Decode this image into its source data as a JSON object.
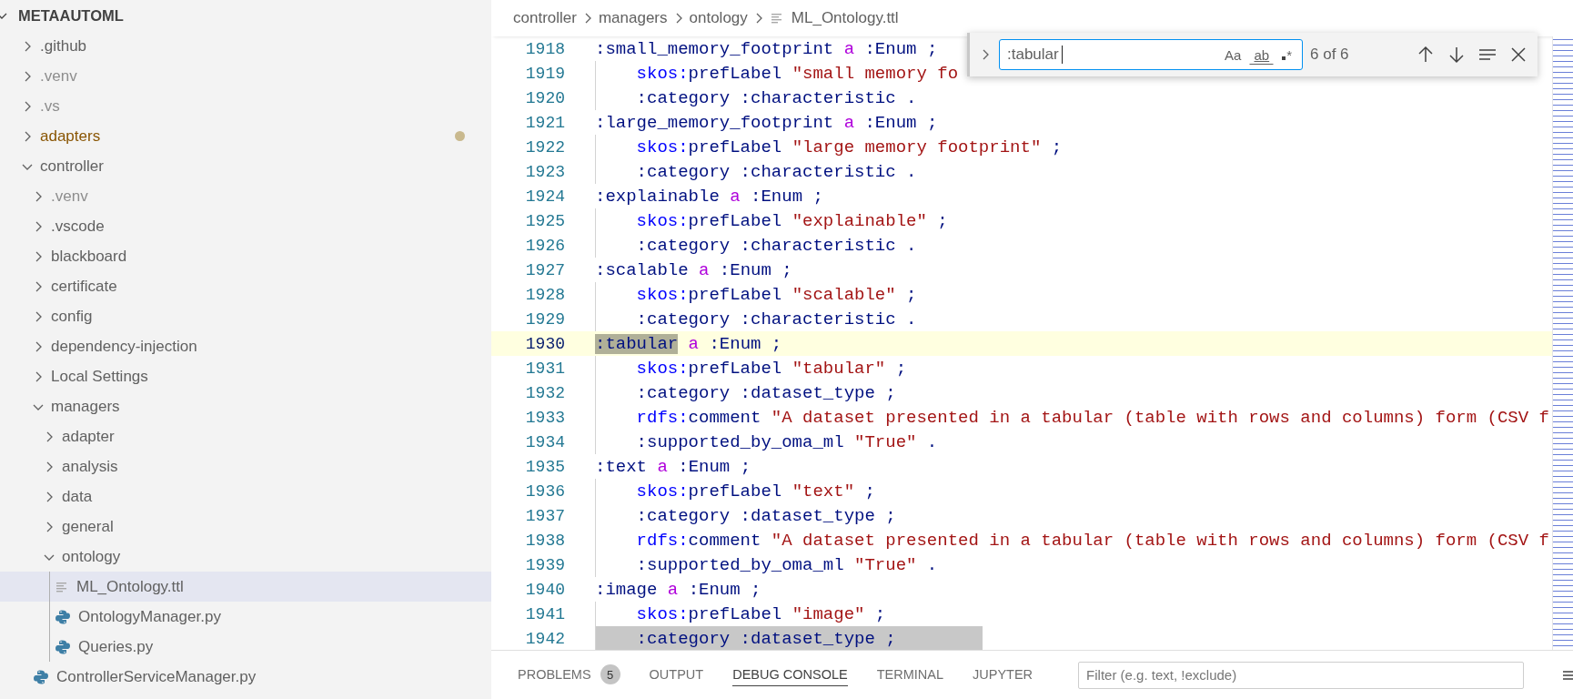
{
  "explorer": {
    "title": "METAAUTOML",
    "expanded": true,
    "items": [
      {
        "label": ".github",
        "kind": "folder",
        "expanded": false,
        "ignored": false,
        "modified": false,
        "selected": false
      },
      {
        "label": ".venv",
        "kind": "folder",
        "expanded": false,
        "ignored": true,
        "modified": false,
        "selected": false
      },
      {
        "label": ".vs",
        "kind": "folder",
        "expanded": false,
        "ignored": true,
        "modified": false,
        "selected": false
      },
      {
        "label": "adapters",
        "kind": "folder",
        "expanded": false,
        "ignored": false,
        "modified": true,
        "selected": false
      },
      {
        "label": "controller",
        "kind": "folder",
        "expanded": true,
        "ignored": false,
        "modified": false,
        "selected": false,
        "children": [
          {
            "label": ".venv",
            "kind": "folder",
            "expanded": false,
            "ignored": true,
            "modified": false,
            "selected": false
          },
          {
            "label": ".vscode",
            "kind": "folder",
            "expanded": false,
            "ignored": false,
            "modified": false,
            "selected": false
          },
          {
            "label": "blackboard",
            "kind": "folder",
            "expanded": false,
            "ignored": false,
            "modified": false,
            "selected": false
          },
          {
            "label": "certificate",
            "kind": "folder",
            "expanded": false,
            "ignored": false,
            "modified": false,
            "selected": false
          },
          {
            "label": "config",
            "kind": "folder",
            "expanded": false,
            "ignored": false,
            "modified": false,
            "selected": false
          },
          {
            "label": "dependency-injection",
            "kind": "folder",
            "expanded": false,
            "ignored": false,
            "modified": false,
            "selected": false
          },
          {
            "label": "Local Settings",
            "kind": "folder",
            "expanded": false,
            "ignored": false,
            "modified": false,
            "selected": false
          },
          {
            "label": "managers",
            "kind": "folder",
            "expanded": true,
            "ignored": false,
            "modified": false,
            "selected": false,
            "children": [
              {
                "label": "adapter",
                "kind": "folder",
                "expanded": false,
                "ignored": false,
                "modified": false,
                "selected": false
              },
              {
                "label": "analysis",
                "kind": "folder",
                "expanded": false,
                "ignored": false,
                "modified": false,
                "selected": false
              },
              {
                "label": "data",
                "kind": "folder",
                "expanded": false,
                "ignored": false,
                "modified": false,
                "selected": false
              },
              {
                "label": "general",
                "kind": "folder",
                "expanded": false,
                "ignored": false,
                "modified": false,
                "selected": false
              },
              {
                "label": "ontology",
                "kind": "folder",
                "expanded": true,
                "ignored": false,
                "modified": false,
                "selected": false,
                "children": [
                  {
                    "label": "ML_Ontology.ttl",
                    "kind": "text",
                    "ignored": false,
                    "modified": false,
                    "selected": true
                  },
                  {
                    "label": "OntologyManager.py",
                    "kind": "python",
                    "ignored": false,
                    "modified": false,
                    "selected": false
                  },
                  {
                    "label": "Queries.py",
                    "kind": "python",
                    "ignored": false,
                    "modified": false,
                    "selected": false
                  }
                ]
              }
            ]
          },
          {
            "label": "ControllerServiceManager.py",
            "kind": "python",
            "ignored": false,
            "modified": false,
            "selected": false
          }
        ]
      }
    ]
  },
  "breadcrumb": [
    {
      "label": "controller",
      "kind": "folder"
    },
    {
      "label": "managers",
      "kind": "folder"
    },
    {
      "label": "ontology",
      "kind": "folder"
    },
    {
      "label": "ML_Ontology.ttl",
      "kind": "file"
    }
  ],
  "editor": {
    "lines": [
      {
        "number": "1918",
        "indented": false,
        "current": false,
        "selected": false,
        "tokens": [
          {
            "kind": "name",
            "text": ":small_memory_footprint "
          },
          {
            "kind": "keyword",
            "text": "a"
          },
          {
            "kind": "name",
            "text": " :Enum ;"
          }
        ]
      },
      {
        "number": "1919",
        "indented": true,
        "current": false,
        "selected": false,
        "tokens": [
          {
            "kind": "prefix",
            "text": "skos:"
          },
          {
            "kind": "name",
            "text": "prefLabel "
          },
          {
            "kind": "string",
            "text": "\"small memory fo"
          }
        ]
      },
      {
        "number": "1920",
        "indented": true,
        "current": false,
        "selected": false,
        "tokens": [
          {
            "kind": "name",
            "text": ":category :characteristic ."
          }
        ]
      },
      {
        "number": "1921",
        "indented": false,
        "current": false,
        "selected": false,
        "tokens": [
          {
            "kind": "name",
            "text": ":large_memory_footprint "
          },
          {
            "kind": "keyword",
            "text": "a"
          },
          {
            "kind": "name",
            "text": " :Enum ;"
          }
        ]
      },
      {
        "number": "1922",
        "indented": true,
        "current": false,
        "selected": false,
        "tokens": [
          {
            "kind": "prefix",
            "text": "skos:"
          },
          {
            "kind": "name",
            "text": "prefLabel "
          },
          {
            "kind": "string",
            "text": "\"large memory footprint\""
          },
          {
            "kind": "name",
            "text": " ;"
          }
        ]
      },
      {
        "number": "1923",
        "indented": true,
        "current": false,
        "selected": false,
        "tokens": [
          {
            "kind": "name",
            "text": ":category :characteristic ."
          }
        ]
      },
      {
        "number": "1924",
        "indented": false,
        "current": false,
        "selected": false,
        "tokens": [
          {
            "kind": "name",
            "text": ":explainable "
          },
          {
            "kind": "keyword",
            "text": "a"
          },
          {
            "kind": "name",
            "text": " :Enum ;"
          }
        ]
      },
      {
        "number": "1925",
        "indented": true,
        "current": false,
        "selected": false,
        "tokens": [
          {
            "kind": "prefix",
            "text": "skos:"
          },
          {
            "kind": "name",
            "text": "prefLabel "
          },
          {
            "kind": "string",
            "text": "\"explainable\""
          },
          {
            "kind": "name",
            "text": " ;"
          }
        ]
      },
      {
        "number": "1926",
        "indented": true,
        "current": false,
        "selected": false,
        "tokens": [
          {
            "kind": "name",
            "text": ":category :characteristic ."
          }
        ]
      },
      {
        "number": "1927",
        "indented": false,
        "current": false,
        "selected": false,
        "tokens": [
          {
            "kind": "name",
            "text": ":scalable "
          },
          {
            "kind": "keyword",
            "text": "a"
          },
          {
            "kind": "name",
            "text": " :Enum ;"
          }
        ]
      },
      {
        "number": "1928",
        "indented": true,
        "current": false,
        "selected": false,
        "tokens": [
          {
            "kind": "prefix",
            "text": "skos:"
          },
          {
            "kind": "name",
            "text": "prefLabel "
          },
          {
            "kind": "string",
            "text": "\"scalable\""
          },
          {
            "kind": "name",
            "text": " ;"
          }
        ]
      },
      {
        "number": "1929",
        "indented": true,
        "current": false,
        "selected": false,
        "tokens": [
          {
            "kind": "name",
            "text": ":category :characteristic ."
          }
        ]
      },
      {
        "number": "1930",
        "indented": false,
        "current": true,
        "selected": false,
        "tokens": [
          {
            "kind": "name",
            "text": ":tabular",
            "match": true
          },
          {
            "kind": "keyword",
            "text": " a",
            "match": false
          },
          {
            "kind": "name",
            "text": " :Enum ;",
            "match": false
          }
        ]
      },
      {
        "number": "1931",
        "indented": true,
        "current": false,
        "selected": false,
        "tokens": [
          {
            "kind": "prefix",
            "text": "skos:"
          },
          {
            "kind": "name",
            "text": "prefLabel "
          },
          {
            "kind": "string",
            "text": "\"tabular\""
          },
          {
            "kind": "name",
            "text": " ;"
          }
        ]
      },
      {
        "number": "1932",
        "indented": true,
        "current": false,
        "selected": false,
        "tokens": [
          {
            "kind": "name",
            "text": ":category :dataset_type ;"
          }
        ]
      },
      {
        "number": "1933",
        "indented": true,
        "current": false,
        "selected": false,
        "tokens": [
          {
            "kind": "prefix",
            "text": "rdfs:"
          },
          {
            "kind": "name",
            "text": "comment "
          },
          {
            "kind": "string",
            "text": "\"A dataset presented in a tabular (table with rows and columns) form (CSV f"
          }
        ]
      },
      {
        "number": "1934",
        "indented": true,
        "current": false,
        "selected": false,
        "tokens": [
          {
            "kind": "name",
            "text": ":supported_by_oma_ml "
          },
          {
            "kind": "string",
            "text": "\"True\""
          },
          {
            "kind": "name",
            "text": " ."
          }
        ]
      },
      {
        "number": "1935",
        "indented": false,
        "current": false,
        "selected": false,
        "tokens": [
          {
            "kind": "name",
            "text": ":text "
          },
          {
            "kind": "keyword",
            "text": "a"
          },
          {
            "kind": "name",
            "text": " :Enum ;"
          }
        ]
      },
      {
        "number": "1936",
        "indented": true,
        "current": false,
        "selected": false,
        "tokens": [
          {
            "kind": "prefix",
            "text": "skos:"
          },
          {
            "kind": "name",
            "text": "prefLabel "
          },
          {
            "kind": "string",
            "text": "\"text\""
          },
          {
            "kind": "name",
            "text": " ;"
          }
        ]
      },
      {
        "number": "1937",
        "indented": true,
        "current": false,
        "selected": false,
        "tokens": [
          {
            "kind": "name",
            "text": ":category :dataset_type ;"
          }
        ]
      },
      {
        "number": "1938",
        "indented": true,
        "current": false,
        "selected": false,
        "tokens": [
          {
            "kind": "prefix",
            "text": "rdfs:"
          },
          {
            "kind": "name",
            "text": "comment "
          },
          {
            "kind": "string",
            "text": "\"A dataset presented in a tabular (table with rows and columns) form (CSV f"
          }
        ]
      },
      {
        "number": "1939",
        "indented": true,
        "current": false,
        "selected": false,
        "tokens": [
          {
            "kind": "name",
            "text": ":supported_by_oma_ml "
          },
          {
            "kind": "string",
            "text": "\"True\""
          },
          {
            "kind": "name",
            "text": " ."
          }
        ]
      },
      {
        "number": "1940",
        "indented": false,
        "current": false,
        "selected": false,
        "tokens": [
          {
            "kind": "name",
            "text": ":image "
          },
          {
            "kind": "keyword",
            "text": "a"
          },
          {
            "kind": "name",
            "text": " :Enum ;"
          }
        ]
      },
      {
        "number": "1941",
        "indented": true,
        "current": false,
        "selected": false,
        "tokens": [
          {
            "kind": "prefix",
            "text": "skos:"
          },
          {
            "kind": "name",
            "text": "prefLabel "
          },
          {
            "kind": "string",
            "text": "\"image\""
          },
          {
            "kind": "name",
            "text": " ;"
          }
        ]
      },
      {
        "number": "1942",
        "indented": true,
        "current": false,
        "selected": true,
        "tokens": [
          {
            "kind": "name",
            "text": ":category :dataset_type ;"
          }
        ]
      }
    ]
  },
  "find": {
    "expanded": false,
    "value": ":tabular",
    "options": [
      {
        "label": "Aa",
        "kind": "case",
        "on": false
      },
      {
        "label": "ab",
        "kind": "word",
        "on": false
      },
      {
        "label": "*",
        "kind": "regex",
        "on": false
      }
    ],
    "count": "6 of 6"
  },
  "panel": {
    "tabs": [
      {
        "label": "PROBLEMS",
        "badge": "5",
        "selected": false
      },
      {
        "label": "OUTPUT",
        "selected": false
      },
      {
        "label": "DEBUG CONSOLE",
        "selected": true
      },
      {
        "label": "TERMINAL",
        "selected": false
      },
      {
        "label": "JUPYTER",
        "selected": false
      }
    ],
    "filter": {
      "placeholder": "Filter (e.g. text, !exclude)"
    }
  }
}
